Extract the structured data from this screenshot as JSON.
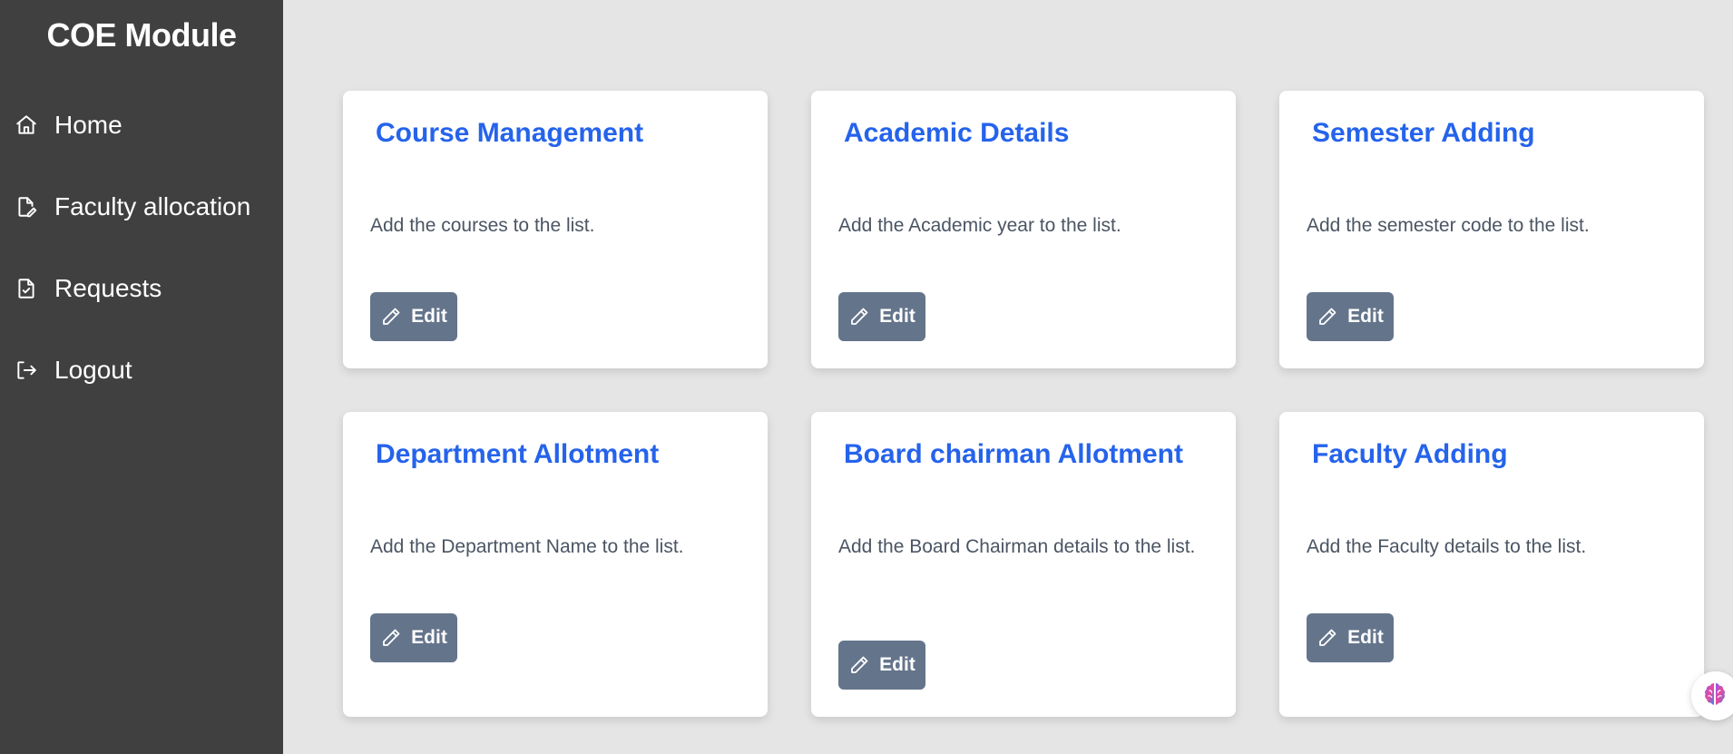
{
  "sidebar": {
    "title": "COE Module",
    "items": [
      {
        "label": "Home",
        "icon": "home-icon"
      },
      {
        "label": "Faculty allocation",
        "icon": "file-edit-icon"
      },
      {
        "label": "Requests",
        "icon": "file-check-icon"
      },
      {
        "label": "Logout",
        "icon": "logout-icon"
      }
    ]
  },
  "cards": [
    {
      "title": "Course Management",
      "description": "Add the courses to the list.",
      "button": "Edit"
    },
    {
      "title": "Academic Details",
      "description": "Add the Academic year to the list.",
      "button": "Edit"
    },
    {
      "title": "Semester Adding",
      "description": "Add the semester code to the list.",
      "button": "Edit"
    },
    {
      "title": "Department Allotment",
      "description": "Add the Department Name to the list.",
      "button": "Edit"
    },
    {
      "title": "Board chairman Allotment",
      "description": "Add the Board Chairman details to the list.",
      "button": "Edit"
    },
    {
      "title": "Faculty Adding",
      "description": "Add the Faculty details to the list.",
      "button": "Edit"
    }
  ],
  "colors": {
    "sidebar_bg": "#404040",
    "page_bg": "#e5e5e5",
    "title_blue": "#2563eb",
    "button_bg": "#64748b"
  }
}
